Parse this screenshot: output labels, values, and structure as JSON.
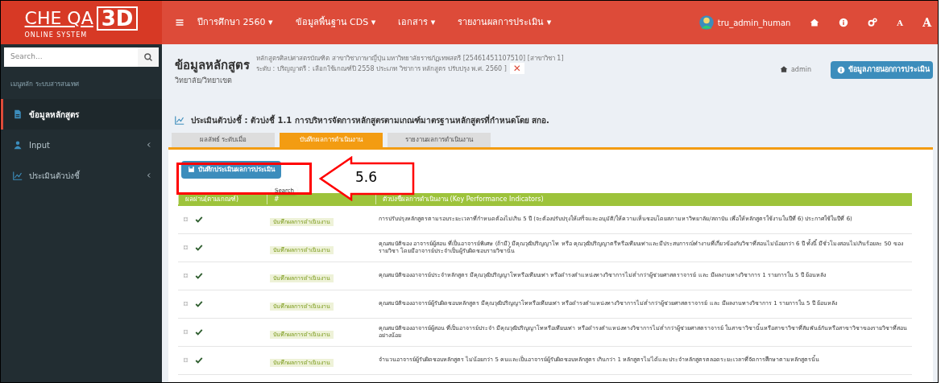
{
  "logo": {
    "text": "CHE QA",
    "accent": "3D",
    "tagline": "ONLINE SYSTEM"
  },
  "top_menu": [
    {
      "label": "ปีการศึกษา 2560 ▾"
    },
    {
      "label": "ข้อมูลพื้นฐาน CDS ▾"
    },
    {
      "label": "เอกสาร ▾"
    },
    {
      "label": "รายงานผลการประเมิน ▾"
    }
  ],
  "user": {
    "name": "tru_admin_human"
  },
  "font_buttons": [
    "A",
    "A"
  ],
  "sidebar": {
    "search": {
      "placeholder": "Search..."
    },
    "header": "เมนูหลัก ระบบสารสนเทศ",
    "items": [
      {
        "label": "ข้อมูลหลักสูตร",
        "selected": true,
        "expandable": false
      },
      {
        "label": "Input",
        "selected": false,
        "expandable": true
      },
      {
        "label": "ประเมินตัวบ่งชี้",
        "selected": false,
        "expandable": true
      }
    ]
  },
  "page": {
    "title": "ข้อมูลหลักสูตร",
    "details": [
      "หลักสูตรศิลปศาสตรบัณฑิต สาขาวิชาภาษาญี่ปุ่น มหาวิทยาลัยราชภัฏเทพสตรี [25461451107510] [สาขาวิชา 1]",
      "ระดับ : ปริญญาตรี : เลือกใช้เกณฑ์ปี 2558 ประเภท วิชาการ หลักสูตร ปรับปรุง พ.ศ. 2560 ]"
    ],
    "close_label": "✕",
    "subtitle": "วิทยาลัย/วิทยาเขต",
    "breadcrumb": "admin",
    "action_button": "ข้อมูลภายนอกการประเมิน"
  },
  "section_title": "ประเมินตัวบ่งชี้ : ตัวบ่งชี้ 1.1 การบริหารจัดการหลักสูตรตามเกณฑ์มาตรฐานหลักสูตรที่กำหนดโดย สกอ.",
  "tabs": [
    {
      "label": "ผลลัพธ์ ระดับเมื่อ",
      "selected": false
    },
    {
      "label": "บันทึกผลการดำเนินงาน",
      "selected": true
    },
    {
      "label": "รายงานผลการดำเนินงาน",
      "selected": false
    }
  ],
  "save_button": "บันทึกประเมินผลการประเมิน",
  "tooltip": "Search",
  "table": {
    "columns": [
      "ผลผ่าน(ตามเกณฑ์)",
      "#",
      "ตัวบ่งชี้ผลการดำเนินงาน (Key Performance Indicators)"
    ],
    "rows": [
      {
        "passed": true,
        "link": "บันทึกผลการดำเนินงาน",
        "indicator": "การปรับปรุงหลักสูตรตามรอบระยะเวลาที่กำหนดต้องไม่เกิน 5 ปี (จะต้องปรับปรุงให้เสร็จและอนุมัติ/ให้ความเห็นชอบโดยสภามหาวิทยาลัย/สถาบัน เพื่อให้หลักสูตรใช้งานในปีที่ 6) ประกาศใช้ในปีที่ 6)"
      },
      {
        "passed": true,
        "link": "บันทึกผลการดำเนินงาน",
        "indicator": "คุณสมบัติของ อาจารย์ผู้สอน ที่เป็นอาจารย์พิเศษ (ถ้ามี) มีคุณวุฒิปริญญาโท หรือ คุณวุฒิปริญญาตรีหรือเทียบเท่าและมีประสบการณ์ทำงานที่เกี่ยวข้องกับวิชาที่สอนไม่น้อยกว่า 6 ปี ทั้งนี้ มีชั่วโมงสอนไม่เกินร้อยละ 50 ของรายวิชา โดยมีอาจารย์ประจำเป็นผู้รับผิดชอบรายวิชานั้น"
      },
      {
        "passed": true,
        "link": "บันทึกผลการดำเนินงาน",
        "indicator": "คุณสมบัติของอาจารย์ประจำหลักสูตร มีคุณวุฒิปริญญาโทหรือเทียบเท่า หรือดำรงตำแหน่งทางวิชาการไม่ต่ำกว่าผู้ช่วยศาสตราจารย์ และ มีผลงานทางวิชาการ 1 รายการใน 5 ปี ย้อนหลัง"
      },
      {
        "passed": true,
        "link": "บันทึกผลการดำเนินงาน",
        "indicator": "คุณสมบัติของอาจารย์ผู้รับผิดชอบหลักสูตร มีคุณวุฒิปริญญาโทหรือเทียบเท่า หรือดำรงตำแหน่งทางวิชาการไม่ต่ำกว่าผู้ช่วยศาสตราจารย์ และ มีผลงานทางวิชาการ 1 รายการใน 5 ปี ย้อนหลัง"
      },
      {
        "passed": true,
        "link": "บันทึกผลการดำเนินงาน",
        "indicator": "คุณสมบัติของอาจารย์ผู้สอน ที่เป็นอาจารย์ประจำ มีคุณวุฒิปริญญาโทหรือเทียบเท่า หรือดำรงตำแหน่งทางวิชาการไม่ต่ำกว่าผู้ช่วยศาสตราจารย์ ในสาขาวิชานั้นหรือสาขาวิชาที่สัมพันธ์กันหรือสาขาวิชาของรายวิชาที่สอนอย่างน้อย"
      },
      {
        "passed": true,
        "link": "บันทึกผลการดำเนินงาน",
        "indicator": "จำนวนอาจารย์ผู้รับผิดชอบหลักสูตร ไม่น้อยกว่า 5 คนและเป็นอาจารย์ผู้รับผิดชอบหลักสูตร เกินกว่า 1 หลักสูตรไม่ได้และประจำหลักสูตรตลอดระยะเวลาที่จัดการศึกษาตามหลักสูตรนั้น"
      }
    ]
  },
  "annotation": {
    "label": "5.6"
  }
}
